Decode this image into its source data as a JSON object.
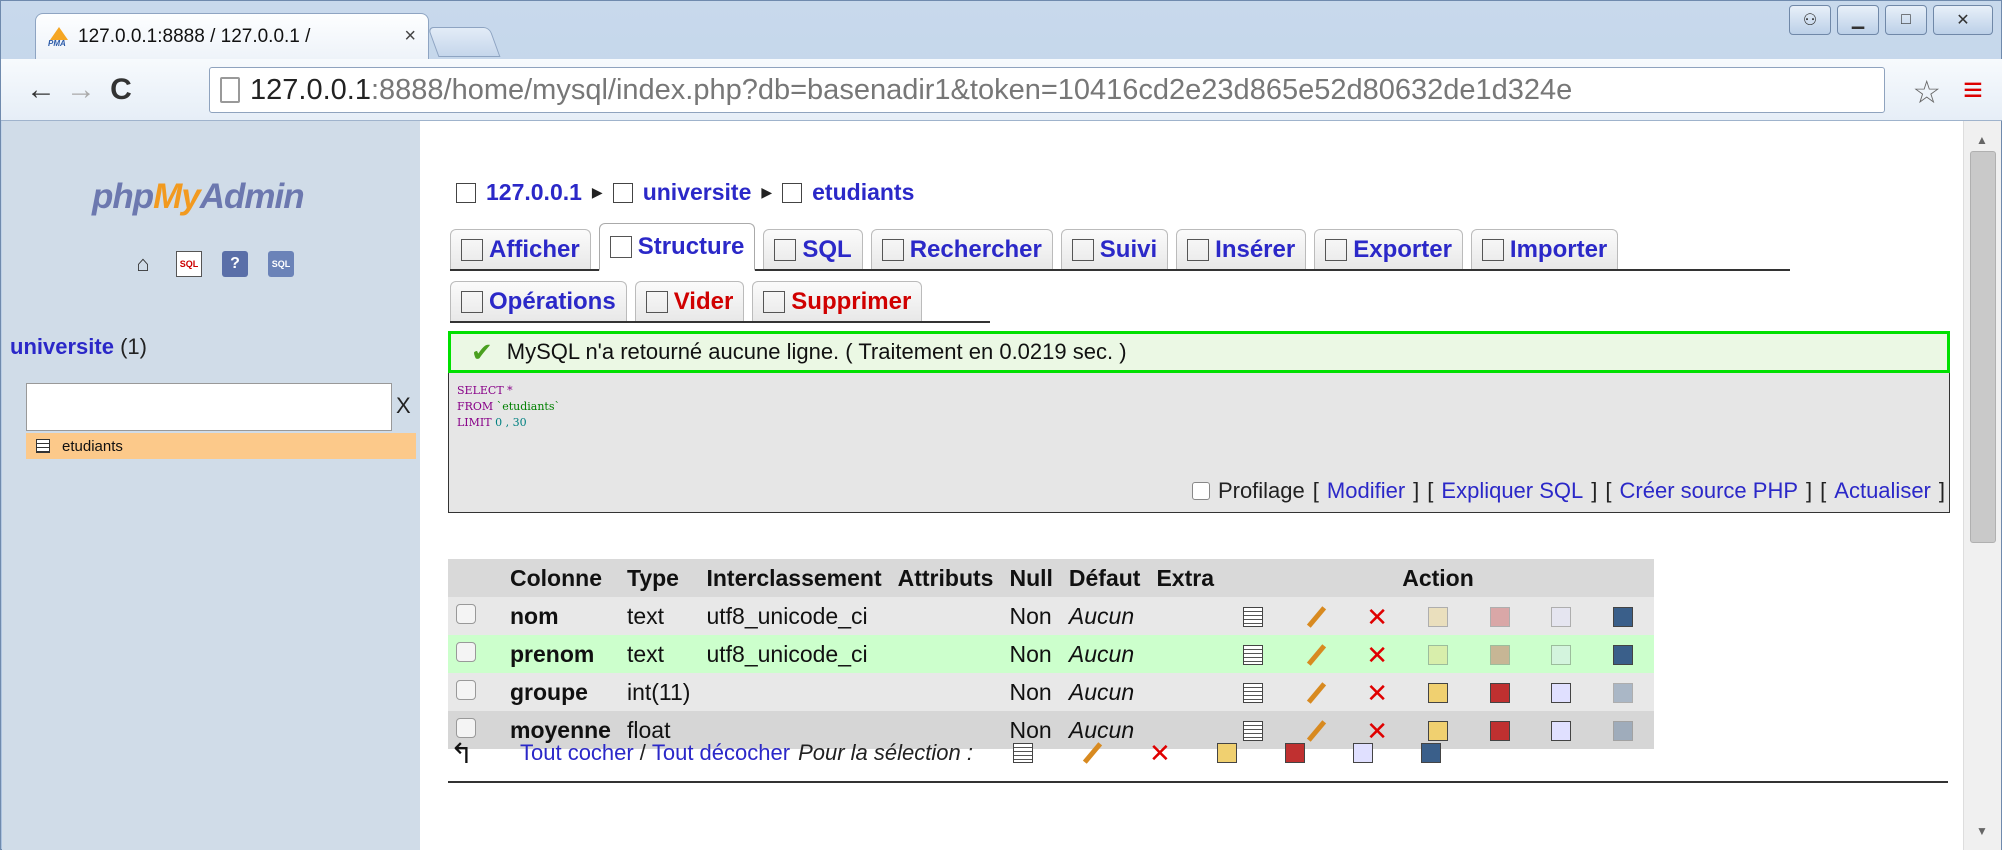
{
  "browser": {
    "tab_title": "127.0.0.1:8888 / 127.0.0.1 /",
    "favicon_text": "PMA",
    "tab_close": "×",
    "url_prefix": "127.0.0.1",
    "url_rest": ":8888/home/mysql/index.php?db=basenadir1&token=10416cd2e23d865e52d80632de1d324e",
    "window_controls": [
      "&#95;",
      "□",
      "X"
    ]
  },
  "sidebar": {
    "logo_php": "php",
    "logo_my": "My",
    "logo_admin": "Admin",
    "db_name": "universite",
    "db_count": "(1)",
    "filter_clear": "X",
    "tables": [
      "etudiants"
    ],
    "icons": [
      "home-icon",
      "sql-query-icon",
      "help-icon",
      "docs-icon"
    ]
  },
  "breadcrumb": {
    "server": "127.0.0.1",
    "database": "universite",
    "table": "etudiants"
  },
  "tabs_row1": [
    {
      "label": "Afficher",
      "icon": "browse-icon"
    },
    {
      "label": "Structure",
      "icon": "structure-icon",
      "active": true
    },
    {
      "label": "SQL",
      "icon": "sql-icon"
    },
    {
      "label": "Rechercher",
      "icon": "search-icon"
    },
    {
      "label": "Suivi",
      "icon": "eye-icon"
    },
    {
      "label": "Insérer",
      "icon": "insert-icon"
    },
    {
      "label": "Exporter",
      "icon": "export-icon"
    },
    {
      "label": "Importer",
      "icon": "import-icon"
    }
  ],
  "tabs_row2": [
    {
      "label": "Opérations",
      "icon": "operations-icon"
    },
    {
      "label": "Vider",
      "icon": "empty-icon",
      "color": "red"
    },
    {
      "label": "Supprimer",
      "icon": "drop-icon",
      "color": "red"
    }
  ],
  "message": {
    "text": "MySQL n'a retourné aucune ligne. ( Traitement en 0.0219 sec. )"
  },
  "sql": {
    "line1": "SELECT *",
    "line2_kw": "FROM",
    "line2_tbl": "`etudiants`",
    "line3_kw": "LIMIT",
    "line3_nums": "0 , 30",
    "profilage": "Profilage",
    "modifier": "Modifier",
    "expliquer": "Expliquer SQL",
    "creer": "Créer source PHP",
    "actualiser": "Actualiser"
  },
  "structure": {
    "headers": [
      "Colonne",
      "Type",
      "Interclassement",
      "Attributs",
      "Null",
      "Défaut",
      "Extra",
      "Action"
    ],
    "rows": [
      {
        "name": "nom",
        "type": "text",
        "collation": "utf8_unicode_ci",
        "attributes": "",
        "null": "Non",
        "default": "Aucun",
        "extra": ""
      },
      {
        "name": "prenom",
        "type": "text",
        "collation": "utf8_unicode_ci",
        "attributes": "",
        "null": "Non",
        "default": "Aucun",
        "extra": ""
      },
      {
        "name": "groupe",
        "type": "int(11)",
        "collation": "",
        "attributes": "",
        "null": "Non",
        "default": "Aucun",
        "extra": ""
      },
      {
        "name": "moyenne",
        "type": "float",
        "collation": "",
        "attributes": "",
        "null": "Non",
        "default": "Aucun",
        "extra": ""
      }
    ]
  },
  "footer": {
    "check_all": "Tout cocher",
    "uncheck_all": "Tout décocher",
    "for_selection": "Pour la sélection :"
  },
  "colors": {
    "link": "#2b28c8",
    "danger": "#d00000",
    "success_border": "#00e000",
    "sidebar_bg": "#d0dce8",
    "selected_table_bg": "#fcc98a"
  }
}
